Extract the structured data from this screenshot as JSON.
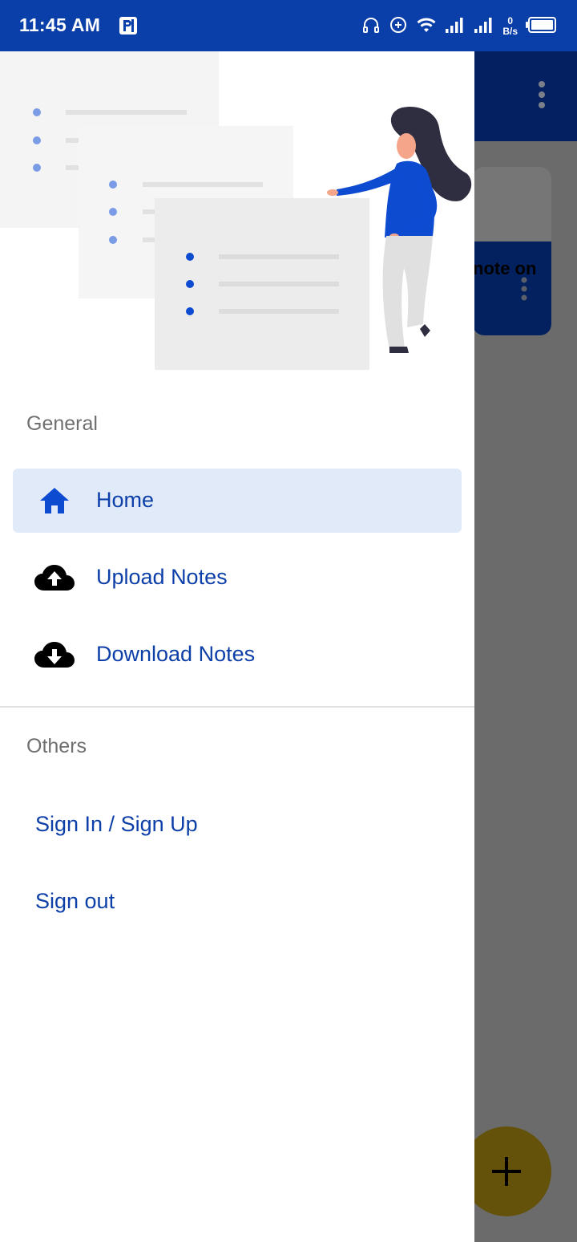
{
  "status_bar": {
    "time": "11:45 AM",
    "net_speed_value": "0",
    "net_speed_unit": "B/s",
    "icons": [
      "parking-app-icon",
      "headset-icon",
      "data-saver-icon",
      "wifi-icon",
      "signal-1-icon",
      "signal-2-icon",
      "battery-icon"
    ]
  },
  "background": {
    "card_text": "note on",
    "fab_icon": "plus-icon"
  },
  "drawer": {
    "general_title": "General",
    "items": [
      {
        "label": "Home",
        "icon": "home-icon",
        "active": true
      },
      {
        "label": "Upload Notes",
        "icon": "cloud-upload-icon",
        "active": false
      },
      {
        "label": "Download Notes",
        "icon": "cloud-download-icon",
        "active": false
      }
    ],
    "others_title": "Others",
    "others": [
      {
        "label": "Sign In / Sign Up"
      },
      {
        "label": "Sign out"
      }
    ]
  },
  "colors": {
    "status_bar": "#0a3ea8",
    "accent": "#0d3fa8",
    "active_bg": "#e1eaf9",
    "scrim": "#6b6b6b"
  }
}
